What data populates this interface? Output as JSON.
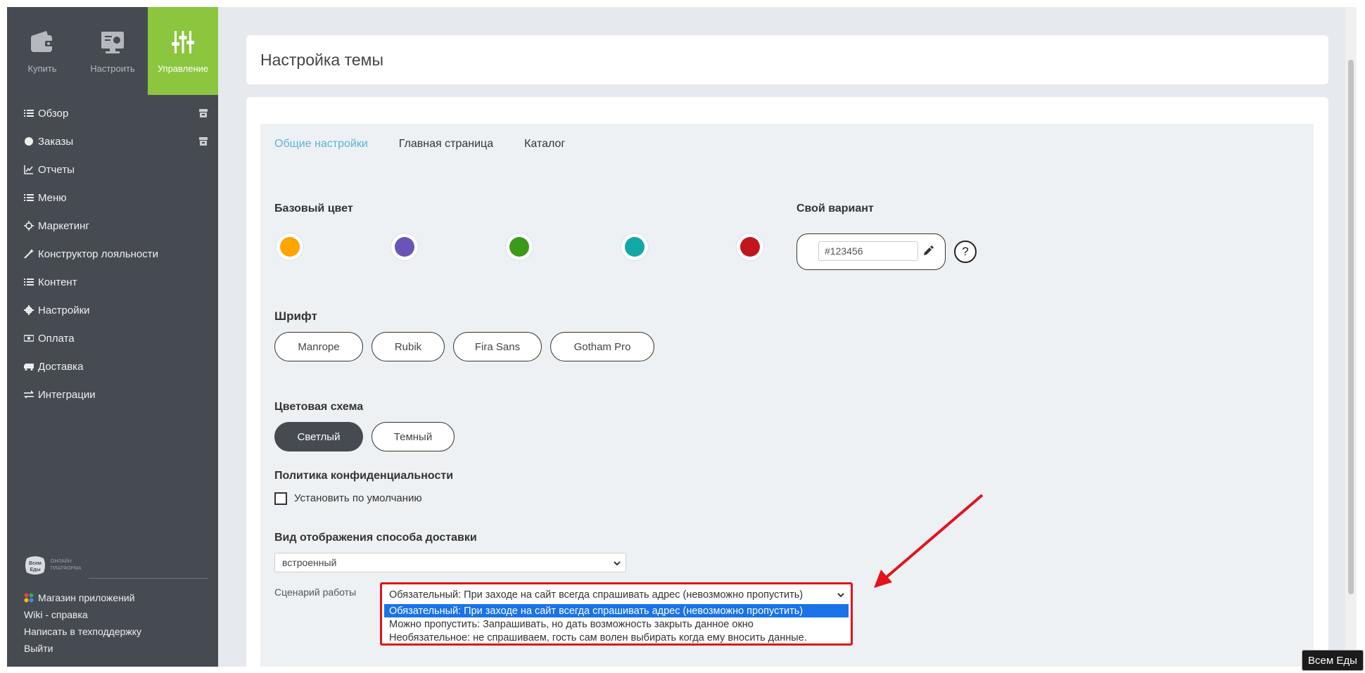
{
  "topnav": {
    "buy": "Купить",
    "configure": "Настроить",
    "manage": "Управление"
  },
  "menu": [
    {
      "label": "Обзор",
      "icon": "list-icon"
    },
    {
      "label": "Заказы",
      "icon": "circle-icon"
    },
    {
      "label": "Отчеты",
      "icon": "line-chart-icon"
    },
    {
      "label": "Меню",
      "icon": "list-icon"
    },
    {
      "label": "Маркетинг",
      "icon": "crosshair-icon"
    },
    {
      "label": "Конструктор лояльности",
      "icon": "magic-wand-icon"
    },
    {
      "label": "Контент",
      "icon": "list-icon"
    },
    {
      "label": "Настройки",
      "icon": "gear-icon"
    },
    {
      "label": "Оплата",
      "icon": "money-icon"
    },
    {
      "label": "Доставка",
      "icon": "truck-icon"
    },
    {
      "label": "Интеграции",
      "icon": "exchange-icon"
    }
  ],
  "brand": {
    "logo_text": "Всем Еды",
    "tagline_1": "ОНЛАЙН",
    "tagline_2": "ПЛАТФОРМА"
  },
  "bottom_links": {
    "app_store": "Магазин приложений",
    "wiki": "Wiki - справка",
    "support": "Написать в техподдержку",
    "logout": "Выйти"
  },
  "page": {
    "title": "Настройка темы"
  },
  "tabs": {
    "general": "Общие настройки",
    "home": "Главная страница",
    "catalog": "Каталог"
  },
  "colors": {
    "label": "Базовый цвет",
    "custom_label": "Свой вариант",
    "swatches": [
      "#ffa500",
      "#6a55b7",
      "#3c9a1a",
      "#13a8a8",
      "#c0171f"
    ],
    "custom_value": "#123456",
    "help": "?"
  },
  "font": {
    "label": "Шрифт",
    "options": [
      "Manrope",
      "Rubik",
      "Fira Sans",
      "Gotham Pro"
    ]
  },
  "scheme": {
    "label": "Цветовая схема",
    "light": "Светлый",
    "dark": "Темный"
  },
  "privacy": {
    "label": "Политика конфиденциальности",
    "checkbox_label": "Установить по умолчанию",
    "checked": false
  },
  "delivery_view": {
    "label": "Вид отображения способа доставки",
    "selected": "встроенный"
  },
  "scenario": {
    "label": "Сценарий работы",
    "selected": "Обязательный: При заходе на сайт всегда спрашивать адрес (невозможно пропустить)",
    "options": [
      "Обязательный: При заходе на сайт всегда спрашивать адрес (невозможно пропустить)",
      "Можно пропустить: Запрашивать, но дать возможность закрыть данное окно",
      "Необязательное: не спрашиваем, гость сам волен выбирать когда ему вносить данные."
    ]
  },
  "badge": "Всем Еды",
  "accent": {
    "green": "#8cc63f",
    "blue": "#5bb3d7",
    "red": "#e0141c",
    "sidebar": "#454b51"
  }
}
